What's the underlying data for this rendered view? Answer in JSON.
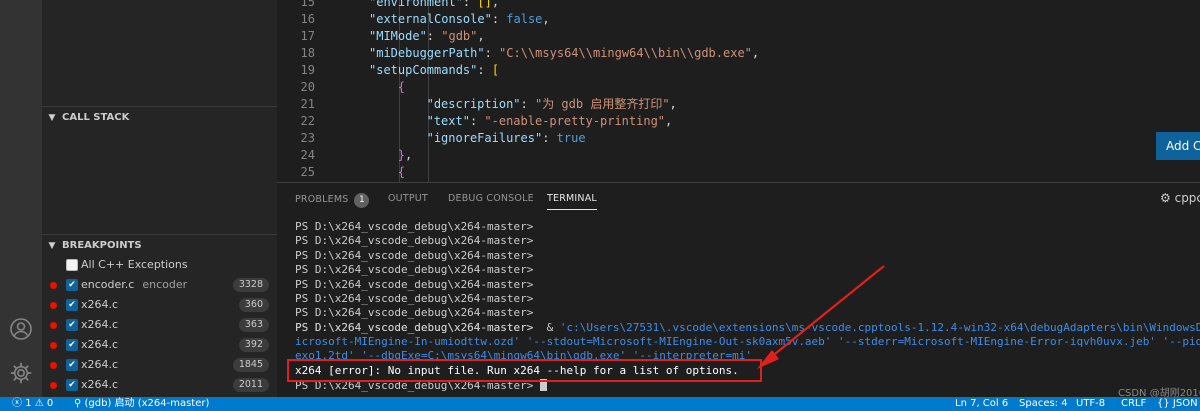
{
  "editor": {
    "lines": [
      {
        "n": "15",
        "indent": 4,
        "parts": [
          [
            "key",
            "\"environment\""
          ],
          [
            "punc",
            ": "
          ],
          [
            "br2",
            "[]"
          ],
          [
            "punc",
            ","
          ]
        ]
      },
      {
        "n": "16",
        "indent": 4,
        "parts": [
          [
            "key",
            "\"externalConsole\""
          ],
          [
            "punc",
            ": "
          ],
          [
            "kw",
            "false"
          ],
          [
            "punc",
            ","
          ]
        ]
      },
      {
        "n": "17",
        "indent": 4,
        "parts": [
          [
            "key",
            "\"MIMode\""
          ],
          [
            "punc",
            ": "
          ],
          [
            "str",
            "\"gdb\""
          ],
          [
            "punc",
            ","
          ]
        ]
      },
      {
        "n": "18",
        "indent": 4,
        "parts": [
          [
            "key",
            "\"miDebuggerPath\""
          ],
          [
            "punc",
            ": "
          ],
          [
            "str",
            "\"C:\\\\msys64\\\\mingw64\\\\bin\\\\gdb.exe\""
          ],
          [
            "punc",
            ","
          ]
        ]
      },
      {
        "n": "19",
        "indent": 4,
        "parts": [
          [
            "key",
            "\"setupCommands\""
          ],
          [
            "punc",
            ": "
          ],
          [
            "br2",
            "["
          ]
        ]
      },
      {
        "n": "20",
        "indent": 8,
        "parts": [
          [
            "br",
            "{"
          ]
        ]
      },
      {
        "n": "21",
        "indent": 12,
        "parts": [
          [
            "key",
            "\"description\""
          ],
          [
            "punc",
            ": "
          ],
          [
            "str",
            "\"为 gdb 启用整齐打印\""
          ],
          [
            "punc",
            ","
          ]
        ]
      },
      {
        "n": "22",
        "indent": 12,
        "parts": [
          [
            "key",
            "\"text\""
          ],
          [
            "punc",
            ": "
          ],
          [
            "str",
            "\"-enable-pretty-printing\""
          ],
          [
            "punc",
            ","
          ]
        ]
      },
      {
        "n": "23",
        "indent": 12,
        "parts": [
          [
            "key",
            "\"ignoreFailures\""
          ],
          [
            "punc",
            ": "
          ],
          [
            "kw",
            "true"
          ]
        ]
      },
      {
        "n": "24",
        "indent": 8,
        "parts": [
          [
            "br",
            "}"
          ],
          [
            "punc",
            ","
          ]
        ]
      },
      {
        "n": "25",
        "indent": 8,
        "parts": [
          [
            "br",
            "{"
          ]
        ]
      }
    ],
    "add_config_label": "Add Co"
  },
  "sidebar": {
    "call_stack_title": "CALL STACK",
    "breakpoints_title": "BREAKPOINTS",
    "breakpoints": [
      {
        "label": "All C++ Exceptions",
        "extra": "",
        "badge": "",
        "dot": false,
        "checked": false
      },
      {
        "label": "encoder.c",
        "extra": "encoder",
        "badge": "3328",
        "dot": true,
        "checked": true
      },
      {
        "label": "x264.c",
        "extra": "",
        "badge": "360",
        "dot": true,
        "checked": true
      },
      {
        "label": "x264.c",
        "extra": "",
        "badge": "363",
        "dot": true,
        "checked": true
      },
      {
        "label": "x264.c",
        "extra": "",
        "badge": "392",
        "dot": true,
        "checked": true
      },
      {
        "label": "x264.c",
        "extra": "",
        "badge": "1845",
        "dot": true,
        "checked": true
      },
      {
        "label": "x264.c",
        "extra": "",
        "badge": "2011",
        "dot": true,
        "checked": true
      }
    ]
  },
  "panel": {
    "tabs": {
      "problems": "PROBLEMS",
      "problems_count": "1",
      "output": "OUTPUT",
      "debug_console": "DEBUG CONSOLE",
      "terminal": "TERMINAL"
    },
    "gear_label": "cppc",
    "terminal_lines": [
      "PS D:\\x264_vscode_debug\\x264-master>",
      "PS D:\\x264_vscode_debug\\x264-master>",
      "PS D:\\x264_vscode_debug\\x264-master>",
      "PS D:\\x264_vscode_debug\\x264-master>",
      "PS D:\\x264_vscode_debug\\x264-master>",
      "PS D:\\x264_vscode_debug\\x264-master>",
      "PS D:\\x264_vscode_debug\\x264-master>",
      "PS D:\\x264_vscode_debug\\x264-master>"
    ],
    "command_prompt": "PS D:\\x264_vscode_debug\\x264-master>",
    "command_amp": "  & ",
    "command_path": "'c:\\Users\\27531\\.vscode\\extensions\\ms-vscode.cpptools-1.12.4-win32-x64\\debugAdapters\\bin\\WindowsDeb",
    "command_line2": "icrosoft-MIEngine-In-umiodttw.ozd' '--stdout=Microsoft-MIEngine-Out-sk0axm5v.aeb' '--stderr=Microsoft-MIEngine-Error-iqvh0uvx.jeb' '--pid=M",
    "command_line3": "exo1.2td' '--dbgExe=C:\\msys64\\mingw64\\bin\\gdb.exe' '--interpreter=mi'",
    "error_line": "x264 [error]: No input file. Run x264 --help for a list of options.",
    "last_prompt": "PS D:\\x264_vscode_debug\\x264-master>",
    "watermark": "CSDN @胡刚2016"
  },
  "statusbar": {
    "errors": "1",
    "warnings": "0",
    "debug_session": "(gdb) 启动 (x264-master)",
    "position": "Ln 7, Col 6",
    "spaces": "Spaces: 4",
    "encoding": "UTF-8",
    "eol": "CRLF",
    "language": "JSON"
  },
  "colors": {
    "activity_bar": "#333333",
    "sidebar": "#252526",
    "editor": "#1e1e1e",
    "status_bar": "#007acc",
    "error_highlight": "#e0201c",
    "breakpoint": "#e51400"
  }
}
